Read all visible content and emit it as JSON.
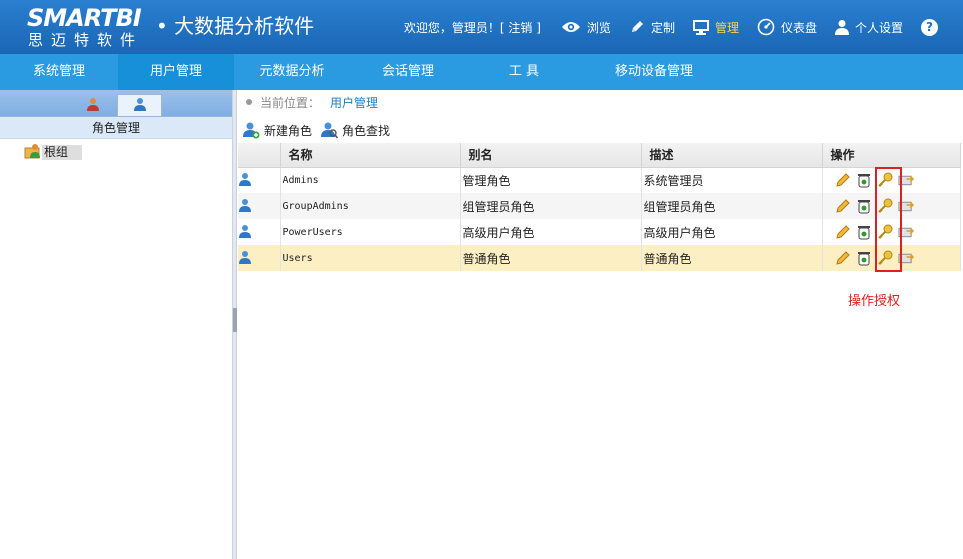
{
  "header": {
    "logo_main": "SMARTBI",
    "logo_sub": "思迈特软件",
    "product_title": "• 大数据分析软件",
    "welcome": "欢迎您，管理员！[ 注销 ]",
    "nav": [
      {
        "label": "浏览",
        "icon": "eye-icon"
      },
      {
        "label": "定制",
        "icon": "pencil-icon"
      },
      {
        "label": "管理",
        "icon": "monitor-icon",
        "active": true
      },
      {
        "label": "仪表盘",
        "icon": "gauge-icon"
      },
      {
        "label": "个人设置",
        "icon": "user-icon"
      }
    ],
    "help_label": "?",
    "active_color": "#ffd54a",
    "brand_color": "#1e6fbf"
  },
  "menubar": {
    "items": [
      "系统管理",
      "用户管理",
      "元数据分析",
      "会话管理",
      "工 具",
      "移动设备管理"
    ],
    "active_index": 1
  },
  "left": {
    "subtitle": "角色管理",
    "tree_root": "根组"
  },
  "main": {
    "breadcrumb_prefix": "当前位置：",
    "breadcrumb_current": "用户管理",
    "toolbar": {
      "new_role": "新建角色",
      "find_role": "角色查找"
    },
    "columns": [
      "名称",
      "别名",
      "描述",
      "操作"
    ],
    "rows": [
      {
        "name": "Admins",
        "alias": "管理角色",
        "desc": "系统管理员"
      },
      {
        "name": "GroupAdmins",
        "alias": "组管理员角色",
        "desc": "组管理员角色"
      },
      {
        "name": "PowerUsers",
        "alias": "高级用户角色",
        "desc": "高级用户角色"
      },
      {
        "name": "Users",
        "alias": "普通角色",
        "desc": "普通角色"
      }
    ],
    "annotation": "操作授权"
  }
}
